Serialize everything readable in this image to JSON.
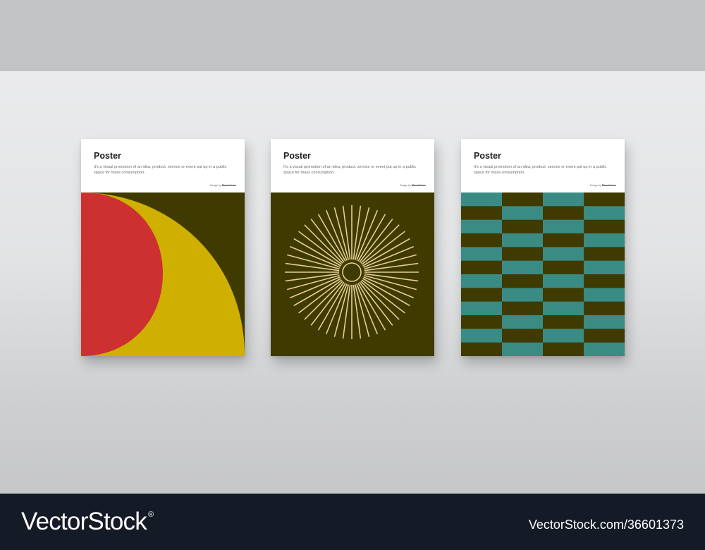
{
  "posters": [
    {
      "title": "Poster",
      "description": "It's a visual promotion of an idea, product, service or event put up in a public space for mass consumption.",
      "credit_prefix": "Design by",
      "credit_name": "Moonidome",
      "artwork": "concentric-half-circles",
      "colors": {
        "background": "#3f3a00",
        "outer": "#cfb000",
        "inner": "#cd3030"
      }
    },
    {
      "title": "Poster",
      "description": "It's a visual promotion of an idea, product, service or event put up in a public space for mass consumption.",
      "credit_prefix": "Design by",
      "credit_name": "Moonidome",
      "artwork": "sunburst",
      "colors": {
        "background": "#3f3a00",
        "rays": "#e3cd94"
      }
    },
    {
      "title": "Poster",
      "description": "It's a visual promotion of an idea, product, service or event put up in a public space for mass consumption.",
      "credit_prefix": "Design by",
      "credit_name": "Moonidome",
      "artwork": "checker-grid",
      "colors": {
        "dark": "#3f3a00",
        "teal": "#3a8b84"
      }
    }
  ],
  "footer": {
    "brand": "VectorStock",
    "registered_mark": "®",
    "image_id": "VectorStock.com/36601373"
  }
}
